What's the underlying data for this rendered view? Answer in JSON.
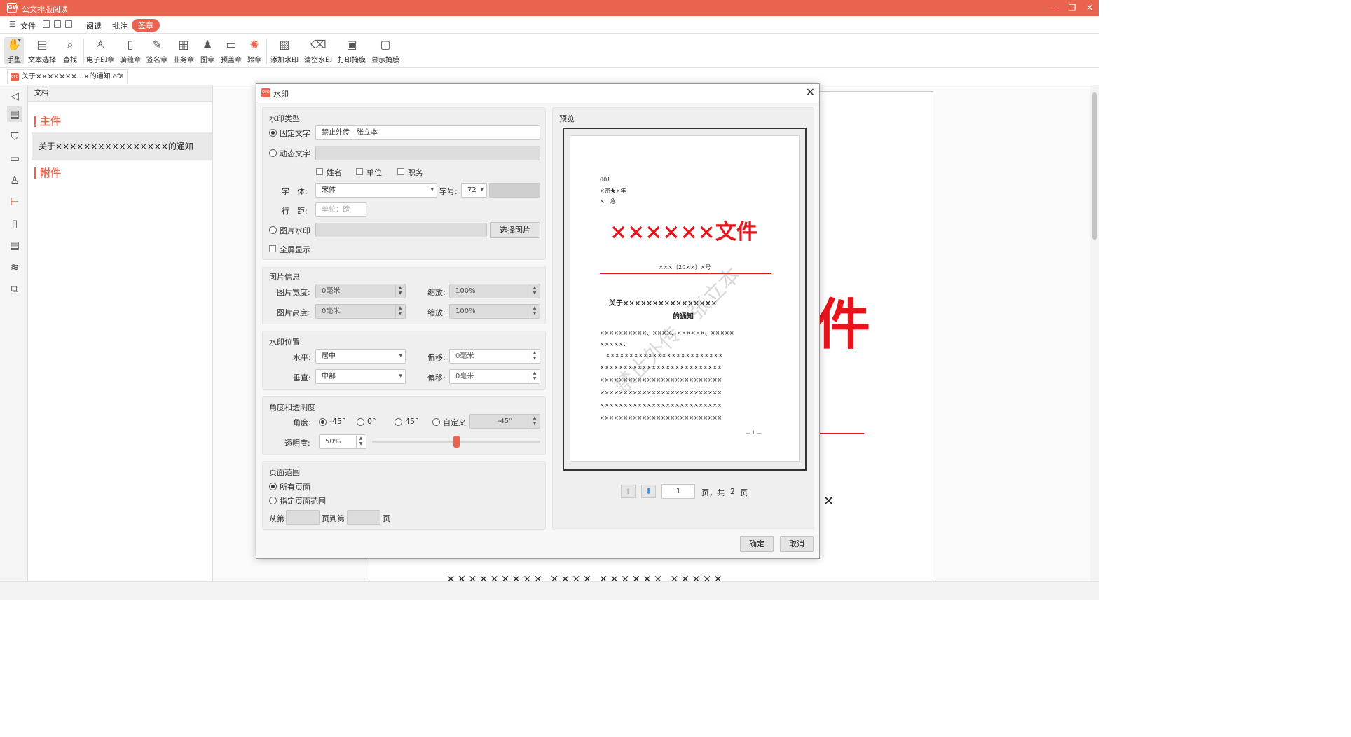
{
  "app": {
    "title": "公文排版阅读",
    "logo": "GW"
  },
  "window_controls": {
    "minimize": "—",
    "restore": "❐",
    "close": "✕"
  },
  "menu": {
    "file": "文件",
    "items": [
      "阅读",
      "批注",
      "签章"
    ]
  },
  "toolbar": [
    "手型",
    "文本选择",
    "查找",
    "电子印章",
    "骑缝章",
    "签名章",
    "业务章",
    "图章",
    "预盖章",
    "验章",
    "添加水印",
    "清空水印",
    "打印掩膜",
    "显示掩膜"
  ],
  "tab": {
    "label": "关于×××××××...×的通知.ofc",
    "close": "✕"
  },
  "panel": {
    "header": "文档",
    "main": "主件",
    "attach": "附件",
    "doc": "关于××××××××××××××××的通知"
  },
  "bg_page": {
    "big": "件",
    "x": "✕",
    "row": "××××××××× ×××× ×××××× ×××××"
  },
  "dialog": {
    "title": "水印",
    "close": "✕",
    "type": {
      "title": "水印类型",
      "fixed": "固定文字",
      "fixed_value": "禁止外传　张立本",
      "dynamic": "动态文字",
      "name": "姓名",
      "unit": "单位",
      "duty": "职务",
      "font_label": "字　体:",
      "font": "宋体",
      "size_label": "字号:",
      "size": "72",
      "spacing_label": "行　距:",
      "spacing_ph": "单位：磅",
      "image": "图片水印",
      "choose": "选择图片",
      "fullscreen": "全屏显示"
    },
    "imginfo": {
      "title": "图片信息",
      "width_label": "图片宽度:",
      "width": "0毫米",
      "height_label": "图片高度:",
      "height": "0毫米",
      "scale_label": "缩放:",
      "scale1": "100%",
      "scale2": "100%"
    },
    "position": {
      "title": "水印位置",
      "h_label": "水平:",
      "h": "居中",
      "v_label": "垂直:",
      "v": "中部",
      "offset_label": "偏移:",
      "offset1": "0毫米",
      "offset2": "0毫米"
    },
    "angle": {
      "title": "角度和透明度",
      "label": "角度:",
      "opts": [
        "-45°",
        "0°",
        "45°",
        "自定义"
      ],
      "custom": "-45°",
      "opacity_label": "透明度:",
      "opacity": "50%",
      "opacity_value": 0.5
    },
    "range": {
      "title": "页面范围",
      "all": "所有页面",
      "specific": "指定页面范围",
      "from": "从第",
      "to": "页到第",
      "end": "页"
    },
    "preview": {
      "title": "预览",
      "page": "1",
      "page_suffix": "页，共",
      "total": "2",
      "total_suffix": "页"
    },
    "ok": "确定",
    "cancel": "取消"
  },
  "preview_doc": {
    "serial": "001",
    "secret": "×密★×年",
    "urgent": "×　急",
    "header": "××××××文件",
    "number": "×××〔20××〕×号",
    "title1": "关于××××××××××××××××",
    "title2": "的通知",
    "lines": [
      "××××××××××、××××、××××××、×××××",
      "×××××：",
      "　×××××××××××××××××××××××××",
      "××××××××××××××××××××××××××",
      "××××××××××××××××××××××××××",
      "××××××××××××××××××××××××××",
      "××××××××××××××××××××××××××",
      "××××××××××××××××××××××××××"
    ],
    "pageno": "— 1 —",
    "watermark": "禁止外传　张立本"
  },
  "colors": {
    "accent": "#e9634f",
    "red": "#e8141c"
  }
}
